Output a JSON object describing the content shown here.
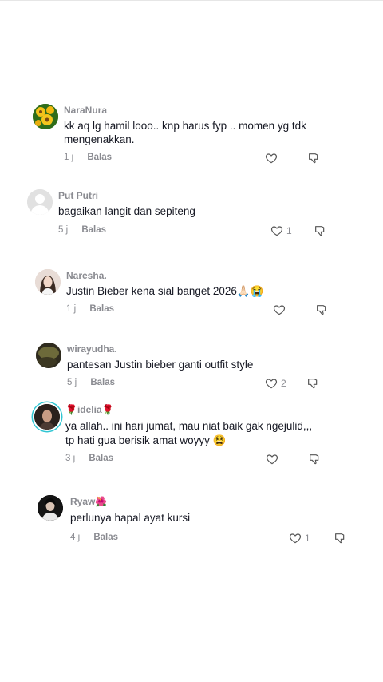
{
  "comments": [
    {
      "username": "NaraNura",
      "text_lines": [
        "kk aq lg hamil looo.. knp harus fyp .. momen yg tdk",
        "mengenakkan."
      ],
      "time": "1 j",
      "reply_label": "Balas",
      "likes": ""
    },
    {
      "username": "Put Putri",
      "text_lines": [
        "bagaikan langit dan sepiteng"
      ],
      "time": "5 j",
      "reply_label": "Balas",
      "likes": "1"
    },
    {
      "username": "Naresha.",
      "text_lines": [
        "Justin Bieber kena sial banget 2026🙏🏻😭"
      ],
      "time": "1 j",
      "reply_label": "Balas",
      "likes": ""
    },
    {
      "username": "wirayudha.",
      "text_lines": [
        "pantesan Justin bieber ganti outfit style"
      ],
      "time": "5 j",
      "reply_label": "Balas",
      "likes": "2"
    },
    {
      "username": "🌹idelia🌹",
      "text_lines": [
        "ya allah.. ini hari jumat, mau niat baik gak ngejulid,,,",
        "tp hati gua berisik amat woyyy 😫"
      ],
      "time": "3 j",
      "reply_label": "Balas",
      "likes": ""
    },
    {
      "username": "Ryaw🌺",
      "text_lines": [
        "perlunya hapal ayat kursi"
      ],
      "time": "4 j",
      "reply_label": "Balas",
      "likes": "1"
    }
  ],
  "icons": {
    "like": "heart-outline-icon",
    "dislike": "thumbs-down-icon"
  },
  "colors": {
    "muted": "#8a8b91",
    "text": "#161823",
    "story_ring": "#31c6d3"
  }
}
